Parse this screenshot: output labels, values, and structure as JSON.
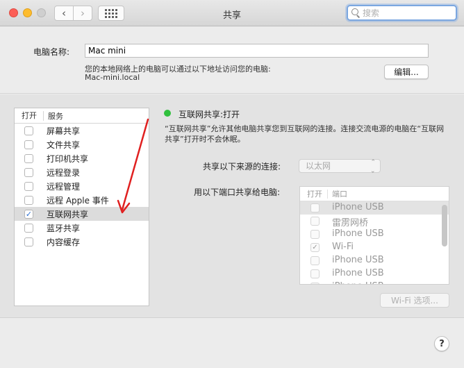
{
  "window": {
    "title": "共享"
  },
  "search": {
    "placeholder": "搜索"
  },
  "computer_name": {
    "label": "电脑名称:",
    "value": "Mac mini",
    "address_description": "您的本地网络上的电脑可以通过以下地址访问您的电脑:",
    "address": "Mac-mini.local",
    "edit_label": "编辑..."
  },
  "services": {
    "header_on": "打开",
    "header_service": "服务",
    "items": [
      {
        "label": "屏幕共享",
        "checked": false
      },
      {
        "label": "文件共享",
        "checked": false
      },
      {
        "label": "打印机共享",
        "checked": false
      },
      {
        "label": "远程登录",
        "checked": false
      },
      {
        "label": "远程管理",
        "checked": false
      },
      {
        "label": "远程 Apple 事件",
        "checked": false
      },
      {
        "label": "互联网共享",
        "checked": true,
        "selected": true
      },
      {
        "label": "蓝牙共享",
        "checked": false
      },
      {
        "label": "内容缓存",
        "checked": false
      }
    ]
  },
  "detail": {
    "status_text": "互联网共享:打开",
    "status_color": "#30c03d",
    "description": "“互联网共享”允许其他电脑共享您到互联网的连接。连接交流电源的电脑在“互联网共享”打开时不会休眠。",
    "share_from_label": "共享以下来源的连接:",
    "share_from_value": "以太网",
    "share_to_label": "用以下端口共享给电脑:",
    "ports_header_on": "打开",
    "ports_header_port": "端口",
    "ports": [
      {
        "label": "iPhone USB",
        "checked": false,
        "selected": true
      },
      {
        "label": "雷雳网桥",
        "checked": false
      },
      {
        "label": "iPhone USB",
        "checked": false
      },
      {
        "label": "Wi-Fi",
        "checked": true
      },
      {
        "label": "iPhone USB",
        "checked": false
      },
      {
        "label": "iPhone USB",
        "checked": false
      },
      {
        "label": "iPhone USB",
        "checked": false
      }
    ],
    "wifi_options_label": "Wi-Fi 选项..."
  },
  "help": {
    "label": "?"
  },
  "annotation": {
    "arrow_color": "#e02020"
  }
}
